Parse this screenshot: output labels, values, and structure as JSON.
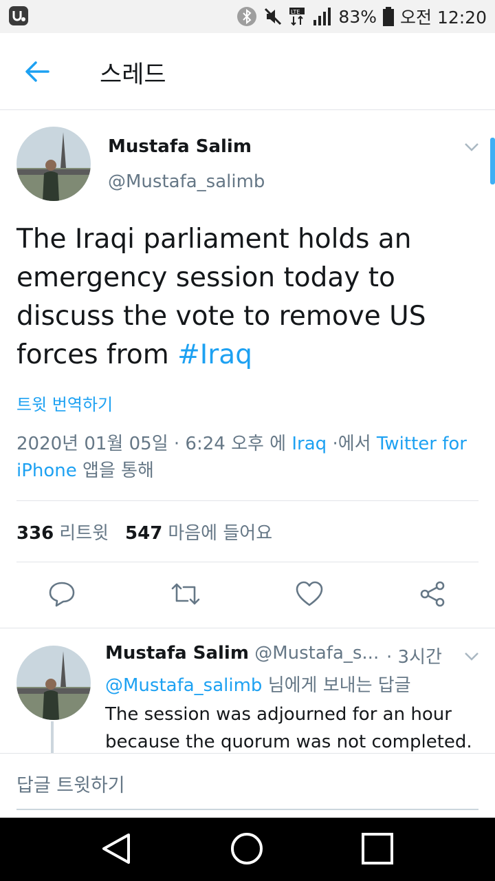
{
  "status_bar": {
    "battery": "83%",
    "time": "오전 12:20",
    "icons": [
      "carrier-logo-icon",
      "bluetooth-icon",
      "mute-icon",
      "lte-icon",
      "signal-icon",
      "battery-icon"
    ]
  },
  "app_bar": {
    "title": "스레드",
    "back_icon": "arrow-left-icon"
  },
  "tweet": {
    "author_name": "Mustafa Salim",
    "author_handle": "@Mustafa_salimb",
    "text": "The Iraqi parliament holds an emergency session today to discuss the vote to remove US forces from",
    "hashtag": "#Iraq",
    "translate_label": "트윗 번역하기",
    "meta": {
      "date": "2020년 01월 05일 · 6:24 오후 에",
      "location": "Iraq",
      "via": "·에서",
      "source": "Twitter for iPhone",
      "source_suffix": "앱을 통해"
    },
    "stats": {
      "retweets": "336",
      "retweets_label": "리트윗",
      "likes": "547",
      "likes_label": "마음에 들어요"
    },
    "actions": [
      "reply-icon",
      "retweet-icon",
      "like-icon",
      "share-icon"
    ]
  },
  "reply": {
    "author_name": "Mustafa Salim",
    "author_handle": "@Mustafa_s...",
    "time": "· 3시간",
    "reply_to_handle": "@Mustafa_salimb",
    "reply_to_suffix": "님에게 보내는 답글",
    "text": "The session was adjourned for an hour because the quorum was not completed."
  },
  "compose": {
    "placeholder": "답글 트윗하기"
  },
  "colors": {
    "accent": "#1da1f2",
    "secondary_text": "#657786",
    "primary_text": "#14171a"
  }
}
